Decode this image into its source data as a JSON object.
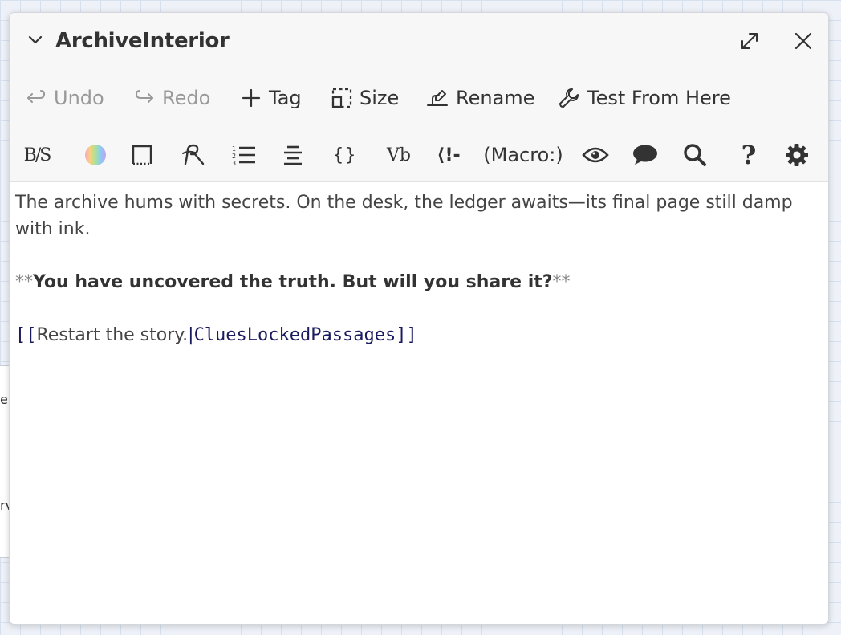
{
  "dialog": {
    "title": "ArchiveInterior"
  },
  "toolbar": {
    "undo_label": "Undo",
    "redo_label": "Redo",
    "tag_label": "Tag",
    "size_label": "Size",
    "rename_label": "Rename",
    "test_label": "Test From Here"
  },
  "format_toolbar": {
    "bold_strike_label": "B/S",
    "verbatim_label": "Vb",
    "macro_label": "(Macro:)",
    "help_label": "?",
    "code_label": "{}",
    "comment_label": "⟨!-"
  },
  "editor": {
    "line1": "The archive hums with secrets. On the desk, the ledger awaits—its final page still damp with ink.",
    "bold_open": "**",
    "bold_text": "You have uncovered the truth. But will you share it?",
    "bold_close": "**",
    "link_open": "[[",
    "link_text": "Restart the story.",
    "link_pipe": "|",
    "link_target": "CluesLockedPassages",
    "link_close": "]]"
  },
  "background": {
    "frag1": "e",
    "frag2": "rv"
  },
  "icons": {
    "collapse": "chevron-down-icon",
    "maximize": "expand-icon",
    "close": "close-icon",
    "undo": "undo-icon",
    "redo": "redo-icon",
    "tag": "plus-icon",
    "size": "resize-icon",
    "rename": "rename-icon",
    "test": "wrench-icon"
  }
}
